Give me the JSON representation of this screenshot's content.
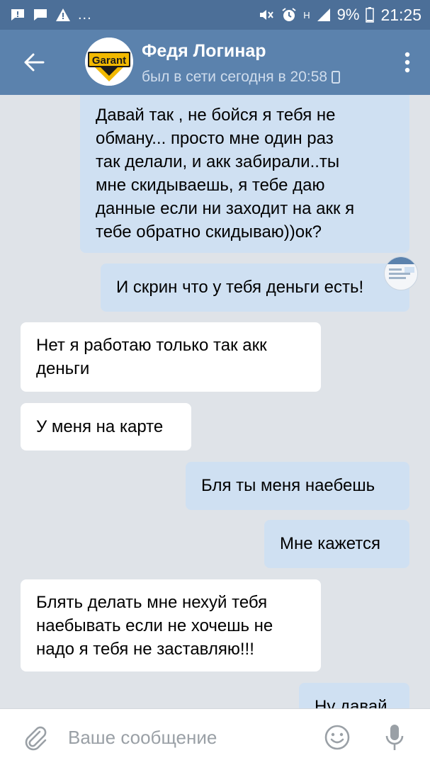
{
  "status_bar": {
    "dots": "...",
    "network": "H",
    "battery": "9%",
    "time": "21:25"
  },
  "header": {
    "back_icon": "arrow-left-icon",
    "avatar_text": "Garant",
    "contact_name": "Федя Логинар",
    "last_seen": "был в сети сегодня в 20:58",
    "menu_icon": "more-vertical-icon"
  },
  "messages": [
    {
      "direction": "out",
      "lines": "Давай так , не бойся я тебя не\nобману... просто мне один раз\nтак делали, и акк забирали..ты\nмне скидываешь, я тебе даю\nданные если ни заходит на акк я\nтебе обратно скидываю))ок?"
    },
    {
      "direction": "out",
      "lines": "И скрин что у тебя деньги есть!"
    },
    {
      "direction": "in",
      "lines": "Нет я работаю только так акк\nденьги"
    },
    {
      "direction": "in",
      "lines": "У меня на карте"
    },
    {
      "direction": "out",
      "lines": "Бля ты меня наебешь"
    },
    {
      "direction": "out",
      "lines": "Мне кажется"
    },
    {
      "direction": "in",
      "lines": "Блять делать мне нехуй тебя\nнаебывать если не хочешь не\nнадо я тебя не заставляю!!!"
    },
    {
      "direction": "out",
      "lines": "Ну давай"
    }
  ],
  "composer": {
    "placeholder": "Ваше сообщение",
    "attach_icon": "paperclip-icon",
    "emoji_icon": "smiley-icon",
    "mic_icon": "microphone-icon"
  },
  "colors": {
    "status_bar": "#4c6f98",
    "header": "#5b82ad",
    "chat_bg": "#dfe3e8",
    "outgoing_bubble": "#cfe0f2",
    "incoming_bubble": "#ffffff"
  }
}
